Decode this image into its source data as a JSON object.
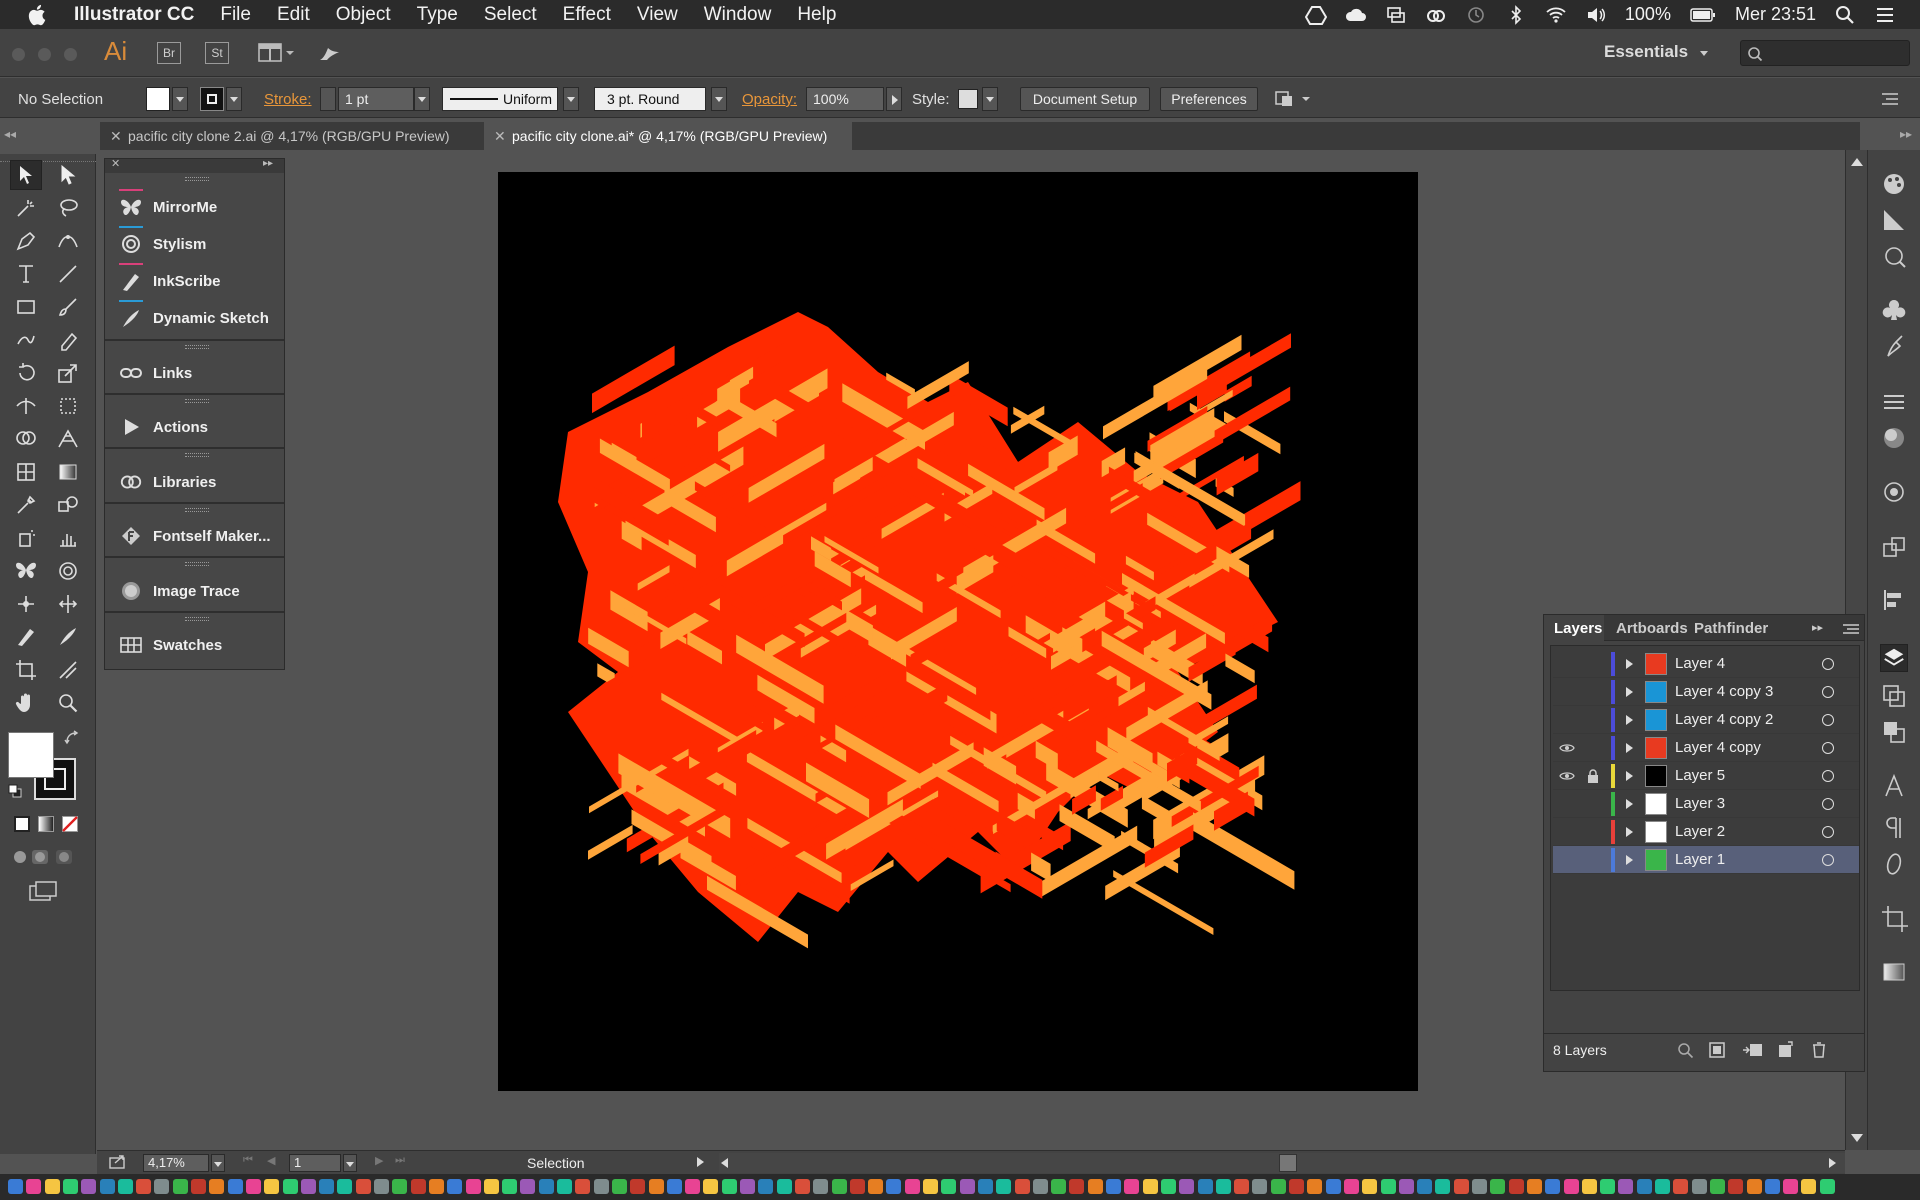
{
  "menubar": {
    "app_name": "Illustrator CC",
    "items": [
      "File",
      "Edit",
      "Object",
      "Type",
      "Select",
      "Effect",
      "View",
      "Window",
      "Help"
    ],
    "battery": "100%",
    "clock": "Mer 23:51"
  },
  "appbar": {
    "logo": "Ai",
    "br_label": "Br",
    "st_label": "St",
    "workspace": "Essentials",
    "search_placeholder": ""
  },
  "control": {
    "selection": "No Selection",
    "stroke_label": "Stroke:",
    "stroke_value": "1 pt",
    "profile": "Uniform",
    "brush": "3 pt. Round",
    "opacity_label": "Opacity:",
    "opacity_value": "100%",
    "style_label": "Style:",
    "doc_setup": "Document Setup",
    "preferences": "Preferences"
  },
  "tabs": [
    {
      "label": "pacific city clone 2.ai @ 4,17% (RGB/GPU Preview)",
      "active": false
    },
    {
      "label": "pacific city clone.ai* @ 4,17% (RGB/GPU Preview)",
      "active": true
    }
  ],
  "plugins": [
    {
      "label": "MirrorMe",
      "icon": "butterfly-icon"
    },
    {
      "label": "Stylism",
      "icon": "spiral-icon"
    },
    {
      "label": "InkScribe",
      "icon": "ink-pen-icon"
    },
    {
      "label": "Dynamic Sketch",
      "icon": "sketch-pen-icon"
    },
    {
      "label": "Links",
      "icon": "links-icon"
    },
    {
      "label": "Actions",
      "icon": "play-icon"
    },
    {
      "label": "Libraries",
      "icon": "creative-cloud-icon"
    },
    {
      "label": "Fontself Maker...",
      "icon": "fontself-icon"
    },
    {
      "label": "Image Trace",
      "icon": "image-trace-icon"
    },
    {
      "label": "Swatches",
      "icon": "swatches-icon"
    }
  ],
  "layers_panel": {
    "tabs": [
      "Layers",
      "Artboards",
      "Pathfinder"
    ],
    "layers": [
      {
        "name": "Layer 4",
        "color": "#4c4cd9",
        "thumb": "#e83a20",
        "visible": false,
        "locked": false,
        "selected": false
      },
      {
        "name": "Layer 4 copy 3",
        "color": "#4c4cd9",
        "thumb": "#1a95d6",
        "visible": false,
        "locked": false,
        "selected": false
      },
      {
        "name": "Layer 4 copy 2",
        "color": "#4c4cd9",
        "thumb": "#1a95d6",
        "visible": false,
        "locked": false,
        "selected": false
      },
      {
        "name": "Layer 4 copy",
        "color": "#4c4cd9",
        "thumb": "#e83a20",
        "visible": true,
        "locked": false,
        "selected": false
      },
      {
        "name": "Layer 5",
        "color": "#e8d83a",
        "thumb": "#000000",
        "visible": true,
        "locked": true,
        "selected": false
      },
      {
        "name": "Layer 3",
        "color": "#3ab54a",
        "thumb": "#ffffff",
        "visible": false,
        "locked": false,
        "selected": false
      },
      {
        "name": "Layer 2",
        "color": "#e8403a",
        "thumb": "#ffffff",
        "visible": false,
        "locked": false,
        "selected": false
      },
      {
        "name": "Layer 1",
        "color": "#4c7ad9",
        "thumb": "#3ab54a",
        "visible": false,
        "locked": false,
        "selected": true
      }
    ],
    "count": "8 Layers"
  },
  "status": {
    "zoom": "4,17%",
    "artboard": "1",
    "tool": "Selection"
  },
  "colors": {
    "art_red": "#ff2a00",
    "art_orange": "#ffa53a",
    "accent_orange": "#e8963a"
  }
}
